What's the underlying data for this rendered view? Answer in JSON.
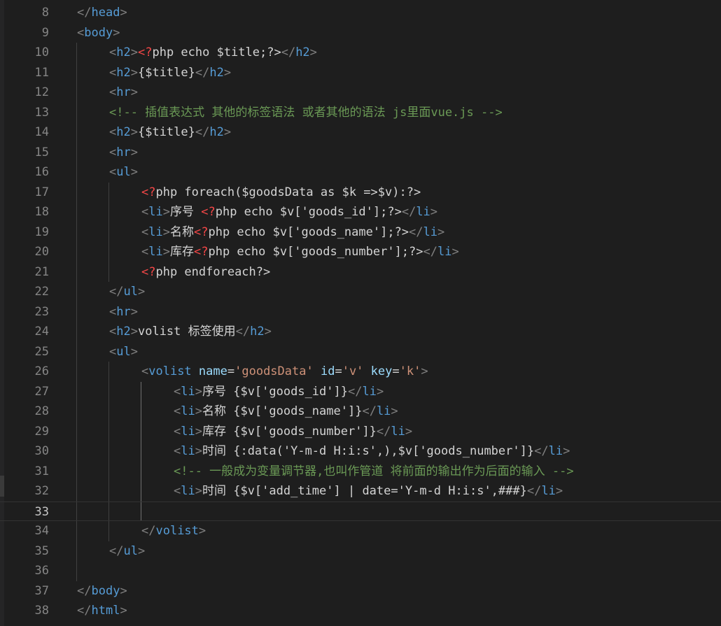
{
  "editor": {
    "colors": {
      "background": "#1e1e1e",
      "tag": "#569cd6",
      "php_delim": "#f44747",
      "attribute": "#9cdcfe",
      "string": "#ce9178",
      "comment": "#6a9955",
      "text": "#d4d4d4",
      "line_number": "#858585"
    },
    "active_line": 33,
    "lines": [
      {
        "n": 8,
        "indent": 0,
        "tokens": [
          [
            "b",
            "</"
          ],
          [
            "t",
            "head"
          ],
          [
            "b",
            ">"
          ]
        ]
      },
      {
        "n": 9,
        "indent": 0,
        "tokens": [
          [
            "b",
            "<"
          ],
          [
            "t",
            "body"
          ],
          [
            "b",
            ">"
          ]
        ]
      },
      {
        "n": 10,
        "indent": 1,
        "tokens": [
          [
            "b",
            "<"
          ],
          [
            "t",
            "h2"
          ],
          [
            "b",
            ">"
          ],
          [
            "p",
            "<?"
          ],
          [
            "x",
            "php echo $title;?>"
          ],
          [
            "b",
            "</"
          ],
          [
            "t",
            "h2"
          ],
          [
            "b",
            ">"
          ]
        ]
      },
      {
        "n": 11,
        "indent": 1,
        "tokens": [
          [
            "b",
            "<"
          ],
          [
            "t",
            "h2"
          ],
          [
            "b",
            ">"
          ],
          [
            "x",
            "{$title}"
          ],
          [
            "b",
            "</"
          ],
          [
            "t",
            "h2"
          ],
          [
            "b",
            ">"
          ]
        ]
      },
      {
        "n": 12,
        "indent": 1,
        "tokens": [
          [
            "b",
            "<"
          ],
          [
            "t",
            "hr"
          ],
          [
            "b",
            ">"
          ]
        ]
      },
      {
        "n": 13,
        "indent": 1,
        "tokens": [
          [
            "c",
            "<!-- 插值表达式 其他的标签语法 或者其他的语法 js里面vue.js -->"
          ]
        ]
      },
      {
        "n": 14,
        "indent": 1,
        "tokens": [
          [
            "b",
            "<"
          ],
          [
            "t",
            "h2"
          ],
          [
            "b",
            ">"
          ],
          [
            "x",
            "{$title}"
          ],
          [
            "b",
            "</"
          ],
          [
            "t",
            "h2"
          ],
          [
            "b",
            ">"
          ]
        ]
      },
      {
        "n": 15,
        "indent": 1,
        "tokens": [
          [
            "b",
            "<"
          ],
          [
            "t",
            "hr"
          ],
          [
            "b",
            ">"
          ]
        ]
      },
      {
        "n": 16,
        "indent": 1,
        "tokens": [
          [
            "b",
            "<"
          ],
          [
            "t",
            "ul"
          ],
          [
            "b",
            ">"
          ]
        ]
      },
      {
        "n": 17,
        "indent": 2,
        "tokens": [
          [
            "p",
            "<?"
          ],
          [
            "x",
            "php foreach($goodsData as $k =>$v):?>"
          ]
        ]
      },
      {
        "n": 18,
        "indent": 2,
        "tokens": [
          [
            "b",
            "<"
          ],
          [
            "t",
            "li"
          ],
          [
            "b",
            ">"
          ],
          [
            "x",
            "序号 "
          ],
          [
            "p",
            "<?"
          ],
          [
            "x",
            "php echo $v['goods_id'];?>"
          ],
          [
            "b",
            "</"
          ],
          [
            "t",
            "li"
          ],
          [
            "b",
            ">"
          ]
        ]
      },
      {
        "n": 19,
        "indent": 2,
        "tokens": [
          [
            "b",
            "<"
          ],
          [
            "t",
            "li"
          ],
          [
            "b",
            ">"
          ],
          [
            "x",
            "名称"
          ],
          [
            "p",
            "<?"
          ],
          [
            "x",
            "php echo $v['goods_name'];?>"
          ],
          [
            "b",
            "</"
          ],
          [
            "t",
            "li"
          ],
          [
            "b",
            ">"
          ]
        ]
      },
      {
        "n": 20,
        "indent": 2,
        "tokens": [
          [
            "b",
            "<"
          ],
          [
            "t",
            "li"
          ],
          [
            "b",
            ">"
          ],
          [
            "x",
            "库存"
          ],
          [
            "p",
            "<?"
          ],
          [
            "x",
            "php echo $v['goods_number'];?>"
          ],
          [
            "b",
            "</"
          ],
          [
            "t",
            "li"
          ],
          [
            "b",
            ">"
          ]
        ]
      },
      {
        "n": 21,
        "indent": 2,
        "tokens": [
          [
            "p",
            "<?"
          ],
          [
            "x",
            "php endforeach?>"
          ]
        ]
      },
      {
        "n": 22,
        "indent": 1,
        "tokens": [
          [
            "b",
            "</"
          ],
          [
            "t",
            "ul"
          ],
          [
            "b",
            ">"
          ]
        ]
      },
      {
        "n": 23,
        "indent": 1,
        "tokens": [
          [
            "b",
            "<"
          ],
          [
            "t",
            "hr"
          ],
          [
            "b",
            ">"
          ]
        ]
      },
      {
        "n": 24,
        "indent": 1,
        "tokens": [
          [
            "b",
            "<"
          ],
          [
            "t",
            "h2"
          ],
          [
            "b",
            ">"
          ],
          [
            "x",
            "volist 标签使用"
          ],
          [
            "b",
            "</"
          ],
          [
            "t",
            "h2"
          ],
          [
            "b",
            ">"
          ]
        ]
      },
      {
        "n": 25,
        "indent": 1,
        "tokens": [
          [
            "b",
            "<"
          ],
          [
            "t",
            "ul"
          ],
          [
            "b",
            ">"
          ]
        ]
      },
      {
        "n": 26,
        "indent": 2,
        "tokens": [
          [
            "b",
            "<"
          ],
          [
            "t",
            "volist"
          ],
          [
            "x",
            " "
          ],
          [
            "a",
            "name"
          ],
          [
            "x",
            "="
          ],
          [
            "s",
            "'goodsData'"
          ],
          [
            "x",
            " "
          ],
          [
            "a",
            "id"
          ],
          [
            "x",
            "="
          ],
          [
            "s",
            "'v'"
          ],
          [
            "x",
            " "
          ],
          [
            "a",
            "key"
          ],
          [
            "x",
            "="
          ],
          [
            "s",
            "'k'"
          ],
          [
            "b",
            ">"
          ]
        ]
      },
      {
        "n": 27,
        "indent": 3,
        "tokens": [
          [
            "b",
            "<"
          ],
          [
            "t",
            "li"
          ],
          [
            "b",
            ">"
          ],
          [
            "x",
            "序号 {$v['goods_id']}"
          ],
          [
            "b",
            "</"
          ],
          [
            "t",
            "li"
          ],
          [
            "b",
            ">"
          ]
        ]
      },
      {
        "n": 28,
        "indent": 3,
        "tokens": [
          [
            "b",
            "<"
          ],
          [
            "t",
            "li"
          ],
          [
            "b",
            ">"
          ],
          [
            "x",
            "名称 {$v['goods_name']}"
          ],
          [
            "b",
            "</"
          ],
          [
            "t",
            "li"
          ],
          [
            "b",
            ">"
          ]
        ]
      },
      {
        "n": 29,
        "indent": 3,
        "tokens": [
          [
            "b",
            "<"
          ],
          [
            "t",
            "li"
          ],
          [
            "b",
            ">"
          ],
          [
            "x",
            "库存 {$v['goods_number']}"
          ],
          [
            "b",
            "</"
          ],
          [
            "t",
            "li"
          ],
          [
            "b",
            ">"
          ]
        ]
      },
      {
        "n": 30,
        "indent": 3,
        "tokens": [
          [
            "b",
            "<"
          ],
          [
            "t",
            "li"
          ],
          [
            "b",
            ">"
          ],
          [
            "x",
            "时间 {:data('Y-m-d H:i:s',),$v['goods_number']}"
          ],
          [
            "b",
            "</"
          ],
          [
            "t",
            "li"
          ],
          [
            "b",
            ">"
          ]
        ]
      },
      {
        "n": 31,
        "indent": 3,
        "tokens": [
          [
            "c",
            "<!-- 一般成为变量调节器,也叫作管道 将前面的输出作为后面的输入 -->"
          ]
        ]
      },
      {
        "n": 32,
        "indent": 3,
        "tokens": [
          [
            "b",
            "<"
          ],
          [
            "t",
            "li"
          ],
          [
            "b",
            ">"
          ],
          [
            "x",
            "时间 {$v['add_time'] | date='Y-m-d H:i:s',###}"
          ],
          [
            "b",
            "</"
          ],
          [
            "t",
            "li"
          ],
          [
            "b",
            ">"
          ]
        ]
      },
      {
        "n": 33,
        "indent": 0,
        "tokens": []
      },
      {
        "n": 34,
        "indent": 2,
        "tokens": [
          [
            "b",
            "</"
          ],
          [
            "t",
            "volist"
          ],
          [
            "b",
            ">"
          ]
        ]
      },
      {
        "n": 35,
        "indent": 1,
        "tokens": [
          [
            "b",
            "</"
          ],
          [
            "t",
            "ul"
          ],
          [
            "b",
            ">"
          ]
        ]
      },
      {
        "n": 36,
        "indent": 0,
        "tokens": []
      },
      {
        "n": 37,
        "indent": 0,
        "tokens": [
          [
            "b",
            "</"
          ],
          [
            "t",
            "body"
          ],
          [
            "b",
            ">"
          ]
        ]
      },
      {
        "n": 38,
        "indent": 0,
        "tokens": [
          [
            "b",
            "</"
          ],
          [
            "t",
            "html"
          ],
          [
            "b",
            ">"
          ]
        ]
      }
    ]
  }
}
